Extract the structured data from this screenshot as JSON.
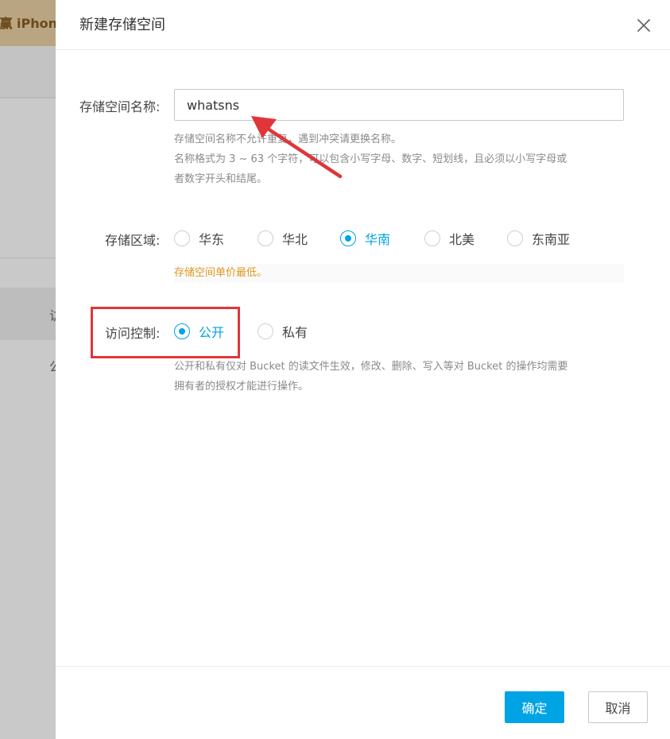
{
  "background": {
    "banner_text": "会赢 iPhon",
    "side_chars": [
      "访",
      "公"
    ]
  },
  "dialog": {
    "title": "新建存储空间",
    "close_icon": "close-icon"
  },
  "form": {
    "name": {
      "label": "存储空间名称:",
      "value": "whatsns",
      "help_lines": [
        "存储空间名称不允许重复，遇到冲突请更换名称。",
        "名称格式为 3 ~ 63 个字符，可以包含小写字母、数字、短划线，且必须以小写字母或",
        "者数字开头和结尾。"
      ]
    },
    "region": {
      "label": "存储区域:",
      "options": [
        "华东",
        "华北",
        "华南",
        "北美",
        "东南亚"
      ],
      "selected": "华南",
      "note": "存储空间单价最低。"
    },
    "access": {
      "label": "访问控制:",
      "options": [
        "公开",
        "私有"
      ],
      "selected": "公开",
      "help_lines": [
        "公开和私有仅对 Bucket 的读文件生效，修改、删除、写入等对 Bucket 的操作均需要",
        "拥有者的授权才能进行操作。"
      ]
    }
  },
  "footer": {
    "confirm_label": "确定",
    "cancel_label": "取消"
  },
  "colors": {
    "accent": "#00a4e4",
    "warning": "#e09a1d",
    "annotation_red": "#e0363a"
  }
}
